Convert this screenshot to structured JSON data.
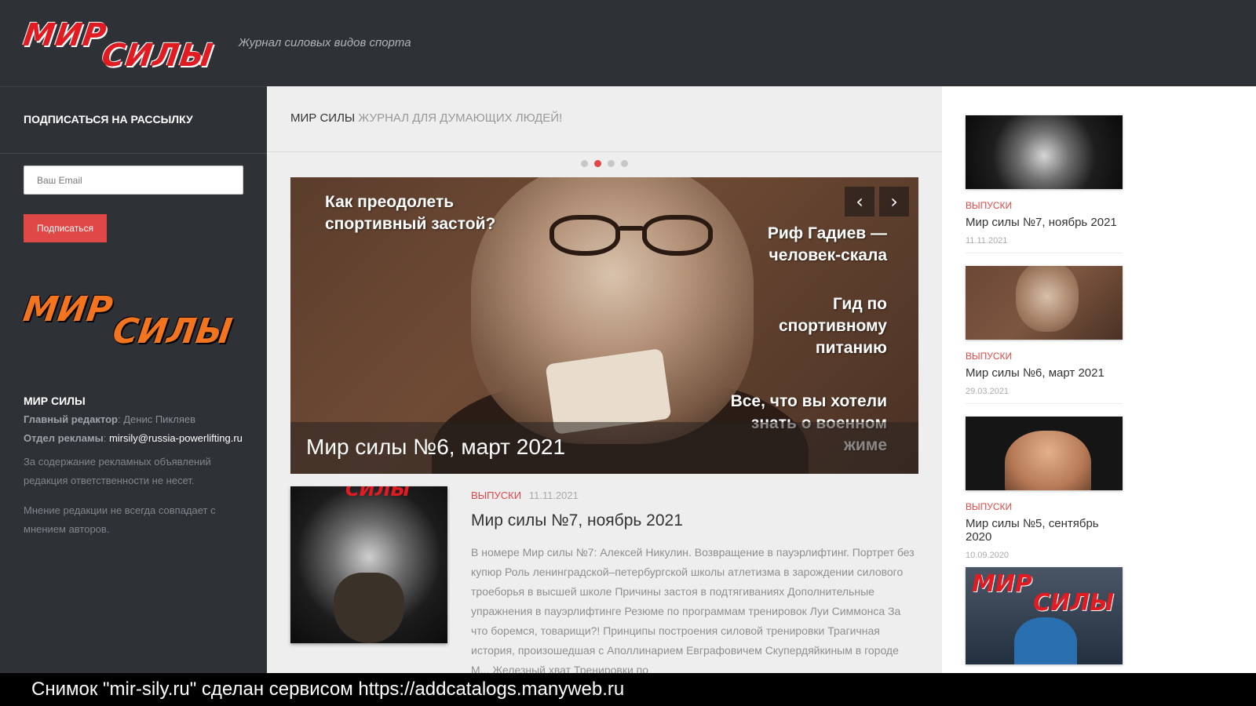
{
  "header": {
    "logo_top": "МИР",
    "logo_bottom": "СИЛЫ",
    "tagline": "Журнал силовых видов спорта"
  },
  "sidebar": {
    "subscribe_title": "ПОДПИСАТЬСЯ НА РАССЫЛКУ",
    "email_placeholder": "Ваш Email",
    "subscribe_button": "Подписаться",
    "logo_top": "МИР",
    "logo_bottom": "СИЛЫ",
    "brand": "МИР СИЛЫ",
    "editor_label": "Главный редактор",
    "editor_value": "Денис Пикляев",
    "ads_label": "Отдел рекламы",
    "ads_value": "mirsily@russia-powerlifting.ru",
    "note1": "За содержание рекламных объявлений редакция ответственности не несет.",
    "note2": "Мнение редакции не всегда совпадает с мнением авторов."
  },
  "main": {
    "title": "МИР СИЛЫ",
    "subtitle": "ЖУРНАЛ ДЛЯ ДУМАЮЩИХ ЛЮДЕЙ!",
    "slider": {
      "active_index": 1,
      "count": 4,
      "text_top_left": "Как преодолеть спортивный застой?",
      "text_r1": "Риф Гадиев — человек-скала",
      "text_r2": "Гид по спортивному питанию",
      "text_r3": "Все, что вы хотели знать о военном жиме",
      "caption": "Мир силы №6, март 2021",
      "prev_icon": "‹",
      "next_icon": "›"
    },
    "post": {
      "thumb_text": "СИЛЫ",
      "category": "ВЫПУСКИ",
      "date": "11.11.2021",
      "title": "Мир силы №7, ноябрь 2021",
      "excerpt": "В номере Мир силы №7: Алексей Никулин. Возвращение в пауэрлифтинг. Портрет без купюр Роль ленинградской–петербургской школы атлетизма в зарождении силового троеборья в высшей школе Причины застоя в подтягиваниях Дополнительные упражнения в пауэрлифтинге Резюме по программам тренировок Луи Симмонса За что боремся, товарищи?! Принципы построения силовой тренировки Трагичная история, произошедшая с Аполлинарием Евграфовичем Скупердяйкиным в городе М... Железный хват Тренировки по"
    }
  },
  "right": {
    "posts": [
      {
        "category": "ВЫПУСКИ",
        "title": "Мир силы №7, ноябрь 2021",
        "date": "11.11.2021"
      },
      {
        "category": "ВЫПУСКИ",
        "title": "Мир силы №6, март 2021",
        "date": "29.03.2021"
      },
      {
        "category": "ВЫПУСКИ",
        "title": "Мир силы №5, сентябрь 2020",
        "date": "10.09.2020"
      }
    ],
    "last_cover_top": "МИР",
    "last_cover_bottom": "СИЛЫ"
  },
  "snapshot": {
    "text": "Снимок \"mir-sily.ru\" сделан сервисом https://addcatalogs.manyweb.ru"
  }
}
